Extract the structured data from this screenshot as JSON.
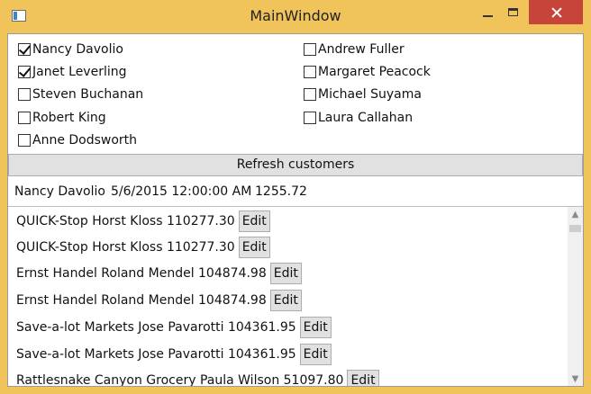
{
  "window": {
    "title": "MainWindow"
  },
  "checkboxes": [
    {
      "label": "Nancy Davolio",
      "checked": true
    },
    {
      "label": "Janet Leverling",
      "checked": true
    },
    {
      "label": "Steven Buchanan",
      "checked": false
    },
    {
      "label": "Robert King",
      "checked": false
    },
    {
      "label": "Anne Dodsworth",
      "checked": false
    },
    {
      "label": "Andrew Fuller",
      "checked": false
    },
    {
      "label": "Margaret Peacock",
      "checked": false
    },
    {
      "label": "Michael Suyama",
      "checked": false
    },
    {
      "label": "Laura Callahan",
      "checked": false
    }
  ],
  "refresh_label": "Refresh customers",
  "selected": {
    "name": "Nancy Davolio",
    "date": "5/6/2015 12:00:00 AM",
    "amount": "1255.72"
  },
  "rows": [
    {
      "text": "QUICK-Stop Horst Kloss  110277.30",
      "edit": "Edit"
    },
    {
      "text": "QUICK-Stop Horst Kloss  110277.30",
      "edit": "Edit"
    },
    {
      "text": "Ernst Handel Roland Mendel  104874.98",
      "edit": "Edit"
    },
    {
      "text": "Ernst Handel Roland Mendel  104874.98",
      "edit": "Edit"
    },
    {
      "text": "Save-a-lot Markets Jose Pavarotti  104361.95",
      "edit": "Edit"
    },
    {
      "text": "Save-a-lot Markets Jose Pavarotti  104361.95",
      "edit": "Edit"
    },
    {
      "text": "Rattlesnake Canyon Grocery Paula Wilson  51097.80",
      "edit": "Edit"
    }
  ],
  "colors": {
    "frame": "#f0c45a",
    "close": "#c7443a",
    "button": "#e1e1e1"
  },
  "icons": {
    "window_icon": "app-window-icon",
    "minimize": "minimize-icon",
    "maximize": "maximize-icon",
    "close": "close-icon",
    "scroll_up": "chevron-up-icon",
    "scroll_down": "chevron-down-icon"
  }
}
